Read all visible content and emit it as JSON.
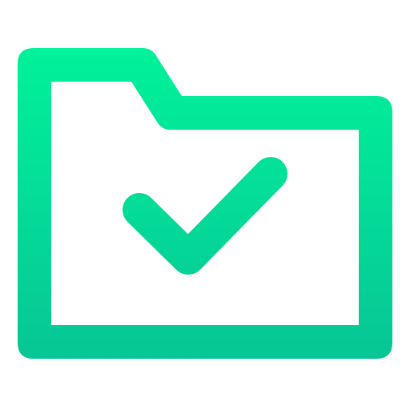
{
  "icon": {
    "name": "folder-check-icon",
    "gradient": {
      "top": "#00F29A",
      "bottom": "#07C695"
    },
    "background": "#ffffff"
  }
}
